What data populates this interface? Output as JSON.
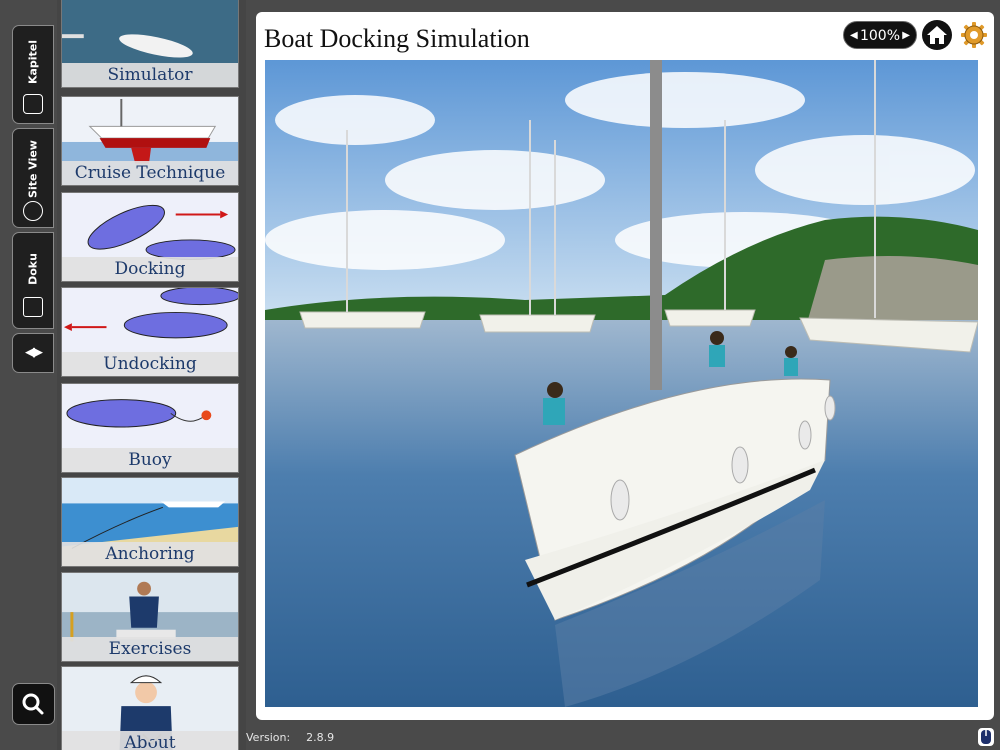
{
  "app": {
    "title": "Boat Docking Simulation"
  },
  "side_tabs": [
    {
      "label": "Kapitel",
      "icon": "book-stack-icon"
    },
    {
      "label": "Site View",
      "icon": "globe-icon"
    },
    {
      "label": "Doku",
      "icon": "open-book-icon"
    }
  ],
  "tab_nav_icon": "left-right-arrows-icon",
  "chapters": [
    {
      "label": "Simulator"
    },
    {
      "label": "Cruise Technique"
    },
    {
      "label": "Docking"
    },
    {
      "label": "Undocking"
    },
    {
      "label": "Buoy"
    },
    {
      "label": "Anchoring"
    },
    {
      "label": "Exercises"
    },
    {
      "label": "About"
    }
  ],
  "toolbar": {
    "zoom": "100%"
  },
  "footer": {
    "version_label": "Version:",
    "version": "2.8.9"
  },
  "colors": {
    "accent": "#1d3a6b",
    "panel": "#4a4a4a",
    "sea": "#3c6b9a",
    "sky": "#7fb0e0"
  }
}
